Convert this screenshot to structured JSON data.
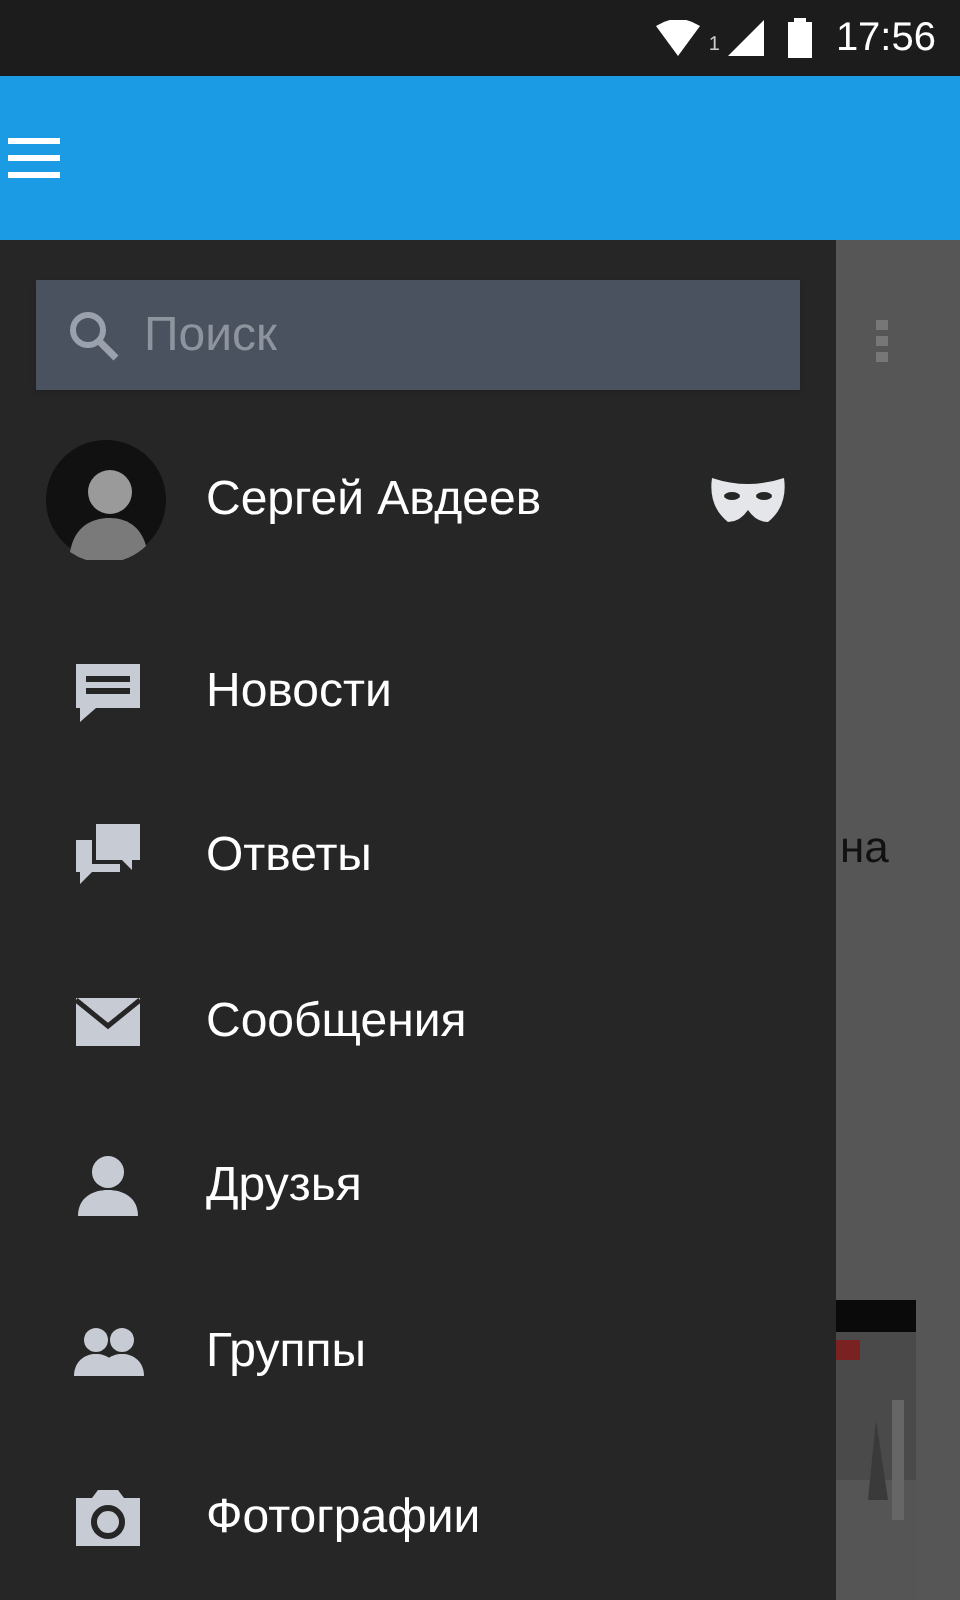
{
  "status_bar": {
    "sim": "1",
    "time": "17:56"
  },
  "drawer": {
    "search": {
      "placeholder": "Поиск"
    },
    "profile": {
      "name": "Сергей Авдеев"
    },
    "items": [
      {
        "label": "Новости",
        "kind": "news"
      },
      {
        "label": "Ответы",
        "kind": "replies"
      },
      {
        "label": "Сообщения",
        "kind": "messages"
      },
      {
        "label": "Друзья",
        "kind": "friends"
      },
      {
        "label": "Группы",
        "kind": "groups"
      },
      {
        "label": "Фотографии",
        "kind": "photos"
      }
    ]
  },
  "background": {
    "text_fragment": "на"
  }
}
